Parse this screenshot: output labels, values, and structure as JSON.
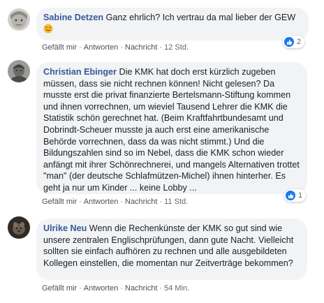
{
  "comments": [
    {
      "author": "Sabine Detzen",
      "text": "Ganz ehrlich? Ich vertrau da mal lieber der GEW",
      "emoji": "smiling-face-emoji",
      "reaction_count": "2",
      "actions": {
        "like": "Gefällt mir",
        "reply": "Antworten",
        "message": "Nachricht"
      },
      "time": "12 Std."
    },
    {
      "author": "Christian Ebinger",
      "text": "Die KMK hat doch erst kürzlich zugeben müssen, dass sie nicht rechnen können! Nicht gelesen? Da musste erst die privat finanzierte Bertelsmann-Stiftung kommen und ihnen vorrechnen, um wieviel Tausend Lehrer die KMK die Statistik schön gerechnet hat. (Beim Kraftfahrtbundesamt und Dobrindt-Scheuer musste ja auch erst eine amerikanische Behörde vorrechnen, dass da was nicht stimmt.) Und die Bildungszahlen sind so im Nebel, dass die KMK schon wieder anfängt mit ihrer Schönrechnerei, und mangels Alternativen trottet \"man\" (der deutsche Schlafmützen-Michel) ihnen hinterher. Es geht ja nur um Kinder ... keine Lobby ...",
      "reaction_count": "1",
      "actions": {
        "like": "Gefällt mir",
        "reply": "Antworten",
        "message": "Nachricht"
      },
      "time": "11 Std."
    },
    {
      "author": "Ulrike Neu",
      "text": "Wenn die Rechenkünste der KMK so gut sind wie unsere zentralen Englischprüfungen, dann gute Nacht. Vielleicht sollten sie einfach aufhören zu rechnen und alle ausgebildeten Kollegen einstellen, die momentan nur Zeitverträge bekommen?",
      "actions": {
        "like": "Gefällt mir",
        "reply": "Antworten",
        "message": "Nachricht"
      },
      "time": "54 Min."
    }
  ],
  "colors": {
    "author": "#385898",
    "bubble": "#f2f3f5",
    "like_blue": "#1877f2",
    "meta": "#606770"
  }
}
